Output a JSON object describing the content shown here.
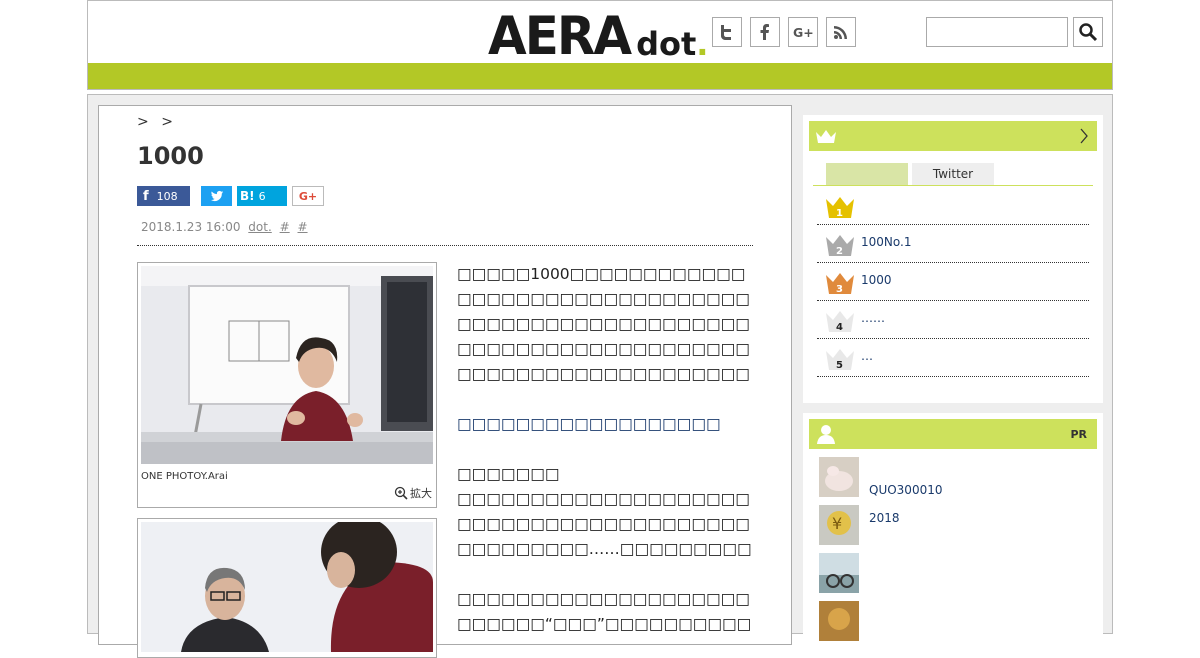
{
  "header": {
    "logo_main": "AERA",
    "logo_sub": "dot",
    "logo_mark": ".",
    "social_icons": [
      "twitter-icon",
      "facebook-icon",
      "google-plus-icon",
      "rss-icon"
    ],
    "search_placeholder": ""
  },
  "colors": {
    "accent": "#b3c826",
    "accent_light": "#cde15c",
    "link": "#1a3a6b"
  },
  "article": {
    "breadcrumbs": [
      ">",
      ">"
    ],
    "title": "1000",
    "share": {
      "facebook_count": "108",
      "hatena_label": "B!",
      "hatena_count": "6",
      "gplus_label": "G+"
    },
    "date": "2018.1.23 16:00",
    "source": "dot.",
    "tag1": "#",
    "tag2": "#",
    "photo1_caption": "ONE PHOTOY.Arai",
    "zoom_label": "拡大",
    "para1": "□□□□□1000□□□□□□□□□□□□□□□□□□□□□□□□□□□□□□□□□□□□□□□□□□□□□□□□□□□□□□□□□□□□□□□□□□□□□□□□□□□□□□□□□□□□□□□□□□□□□□□□□□□□□□□□□□□□□□□□□□□□□□□□□□□□□□□□□",
    "link": "□□□□□□□□□□□□□□□□□□",
    "para2_head": "□□□□□□□",
    "para2": "□□□□□□□□□□□□□□□□□□□□□□□□□□□□□□□□□□□□□□□□□□□□□□□□□……□□□□□□□□□□□□□□□□□□□□□□□□□□□□□□□",
    "para3": "□□□□□□□□□□□□□□□□□□□□□□□□□□“□□□”□□□□□□□□□□□□□□□□□□□□□□□□□□"
  },
  "sidebar": {
    "ranking": {
      "tabs": [
        "",
        "Twitter"
      ],
      "items": [
        {
          "rank": "1",
          "text": ""
        },
        {
          "rank": "2",
          "text": "100No.1"
        },
        {
          "rank": "3",
          "text": "1000"
        },
        {
          "rank": "4",
          "text": "……"
        },
        {
          "rank": "5",
          "text": "…"
        }
      ]
    },
    "pr": {
      "label": "PR",
      "items": [
        "QUO300010",
        "2018",
        "",
        ""
      ]
    }
  }
}
